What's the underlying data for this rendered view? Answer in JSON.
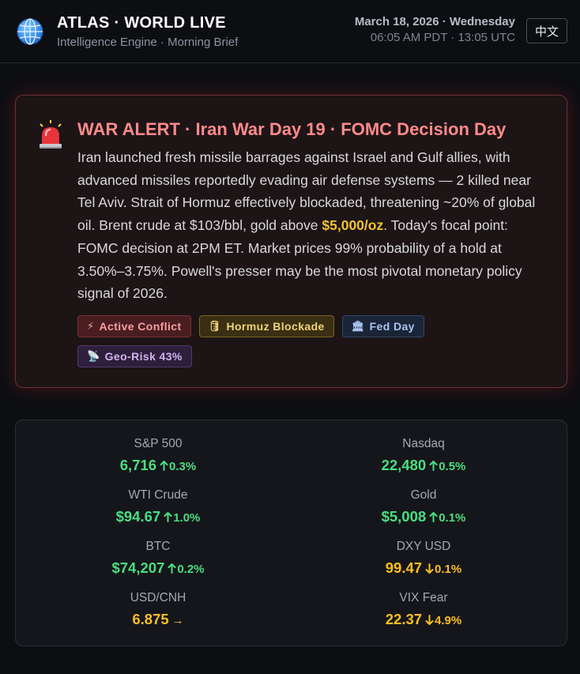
{
  "header": {
    "title": "ATLAS · WORLD LIVE",
    "subtitle": "Intelligence Engine · Morning Brief",
    "date": "March 18, 2026 · Wednesday",
    "time": "06:05 AM PDT · 13:05 UTC",
    "lang_button": "中文",
    "icon": "globe-icon"
  },
  "alert": {
    "icon": "siren-icon",
    "title": "WAR ALERT · Iran War Day 19 · FOMC Decision Day",
    "text_before": "Iran launched fresh missile barrages against Israel and Gulf allies, with advanced missiles reportedly evading air defense systems — 2 killed near Tel Aviv. Strait of Hormuz effectively blockaded, threatening ~20% of global oil. Brent crude at $103/bbl, gold above ",
    "text_highlight": "$5,000/oz",
    "text_after": ". Today's focal point: FOMC decision at 2PM ET. Market prices 99% probability of a hold at 3.50%–3.75%. Powell's presser may be the most pivotal monetary policy signal of 2026.",
    "tags": [
      {
        "icon": "⚡",
        "label": "Active Conflict"
      },
      {
        "icon": "🛢",
        "label": "Hormuz Blockade"
      },
      {
        "icon": "🏛",
        "label": "Fed Day"
      },
      {
        "icon": "📡",
        "label": "Geo-Risk 43%"
      }
    ]
  },
  "markets": [
    {
      "label": "S&P 500",
      "value": "6,716",
      "change": "0.3%",
      "dir": "up"
    },
    {
      "label": "Nasdaq",
      "value": "22,480",
      "change": "0.5%",
      "dir": "up"
    },
    {
      "label": "WTI Crude",
      "value": "$94.67",
      "change": "1.0%",
      "dir": "up"
    },
    {
      "label": "Gold",
      "value": "$5,008",
      "change": "0.1%",
      "dir": "up"
    },
    {
      "label": "BTC",
      "value": "$74,207",
      "change": "0.2%",
      "dir": "up"
    },
    {
      "label": "DXY USD",
      "value": "99.47",
      "change": "0.1%",
      "dir": "down"
    },
    {
      "label": "USD/CNH",
      "value": "6.875",
      "change": "→",
      "dir": "flat"
    },
    {
      "label": "VIX Fear",
      "value": "22.37",
      "change": "4.9%",
      "dir": "down"
    }
  ],
  "colors": {
    "up": "#4ade80",
    "down": "#fbbf24",
    "alert_title": "#ff8a8a",
    "highlight": "#f2c230"
  }
}
